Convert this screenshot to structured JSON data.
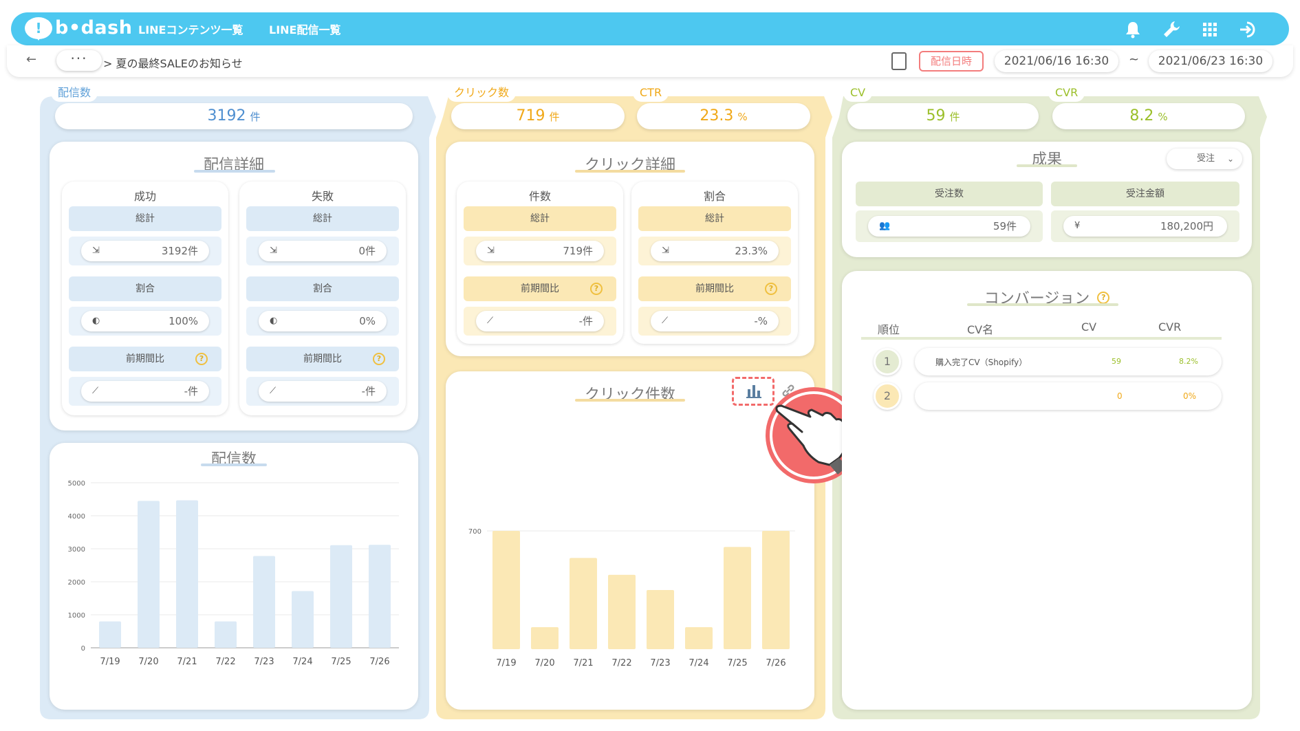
{
  "header": {
    "logo": "b•dash",
    "nav": [
      "LINEコンテンツ一覧",
      "LINE配信一覧"
    ]
  },
  "subbar": {
    "breadcrumb_dots": "···",
    "breadcrumb": "> 夏の最終SALEのお知らせ",
    "date_label": "配信日時",
    "date_from": "2021/06/16 16:30",
    "date_sep": "~",
    "date_to": "2021/06/23 16:30"
  },
  "delivery": {
    "kpi_label": "配信数",
    "kpi_value": "3192",
    "kpi_unit": "件",
    "detail_title": "配信詳細",
    "success": {
      "title": "成功",
      "total_label": "総計",
      "total": "3192件",
      "ratio_label": "割合",
      "ratio": "100%",
      "prev_label": "前期間比",
      "prev": "-件"
    },
    "failure": {
      "title": "失敗",
      "total_label": "総計",
      "total": "0件",
      "ratio_label": "割合",
      "ratio": "0%",
      "prev_label": "前期間比",
      "prev": "-件"
    },
    "chart_title": "配信数"
  },
  "click": {
    "kpi_label": "クリック数",
    "kpi_value": "719",
    "kpi_unit": "件",
    "ctr_label": "CTR",
    "ctr_value": "23.3",
    "ctr_unit": "%",
    "detail_title": "クリック詳細",
    "count": {
      "title": "件数",
      "total_label": "総計",
      "total": "719件",
      "prev_label": "前期間比",
      "prev": "-件"
    },
    "ratio": {
      "title": "割合",
      "total_label": "総計",
      "total": "23.3%",
      "prev_label": "前期間比",
      "prev": "-%"
    },
    "chart_title": "クリック件数"
  },
  "cv": {
    "kpi_label": "CV",
    "kpi_value": "59",
    "kpi_unit": "件",
    "cvr_label": "CVR",
    "cvr_value": "8.2",
    "cvr_unit": "%",
    "result_title": "成果",
    "result_select": "受注",
    "orders_label": "受注数",
    "orders_value": "59件",
    "amount_label": "受注金額",
    "amount_value": "180,200円",
    "conversion_title": "コンバージョン",
    "table_headers": [
      "順位",
      "CV名",
      "CV",
      "CVR"
    ],
    "rows": [
      {
        "rank": "1",
        "name": "購入完了CV（Shopify）",
        "cv": "59",
        "cvr": "8.2%"
      },
      {
        "rank": "2",
        "name": "",
        "cv": "0",
        "cvr": "0%"
      }
    ]
  },
  "colors": {
    "blue": "#4dc8f0",
    "blue_light": "#dceaf6",
    "yellow": "#fbe8b5",
    "yellow_text": "#f0a818",
    "green": "#e4ebd2",
    "green_text": "#9bbf2a",
    "red": "#f37c7c"
  },
  "chart_data": [
    {
      "type": "bar",
      "title": "配信数",
      "categories": [
        "7/19",
        "7/20",
        "7/21",
        "7/22",
        "7/23",
        "7/24",
        "7/25",
        "7/26"
      ],
      "values": [
        800,
        4450,
        4470,
        800,
        2780,
        1720,
        3110,
        3120
      ],
      "yticks": [
        0,
        1000,
        2000,
        3000,
        4000,
        5000
      ],
      "ylim": [
        0,
        5000
      ],
      "grid": true
    },
    {
      "type": "bar",
      "title": "クリック件数",
      "categories": [
        "7/19",
        "7/20",
        "7/21",
        "7/22",
        "7/23",
        "7/24",
        "7/25",
        "7/26"
      ],
      "values": [
        700,
        130,
        540,
        440,
        350,
        130,
        605,
        700
      ],
      "yticks": [
        700
      ],
      "ylim": [
        0,
        700
      ],
      "grid": true
    }
  ]
}
